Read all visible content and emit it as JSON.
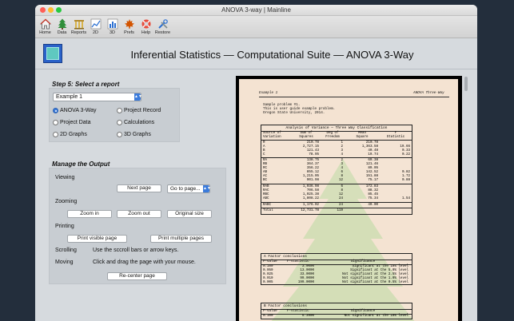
{
  "window": {
    "title": "ANOVA 3-way | Mainline"
  },
  "toolbar": {
    "items": [
      {
        "label": "Home",
        "icon": "home-icon"
      },
      {
        "label": "Data",
        "icon": "tree-icon"
      },
      {
        "label": "Reports",
        "icon": "columns-icon"
      },
      {
        "label": "2D",
        "icon": "line-chart-icon"
      },
      {
        "label": "3D",
        "icon": "bar-chart-icon"
      },
      {
        "label": "Prefs",
        "icon": "maple-leaf-icon"
      },
      {
        "label": "Help",
        "icon": "lifebuoy-icon"
      },
      {
        "label": "Restore",
        "icon": "tools-icon"
      }
    ]
  },
  "header": {
    "title": "Inferential Statistics — Computational Suite — ANOVA 3-Way"
  },
  "step5": {
    "title": "Step 5: Select a report",
    "selected_example": "Example 1",
    "options": [
      "ANOVA 3-Way",
      "Project Record",
      "Project Data",
      "Calculations",
      "2D Graphs",
      "3D Graphs"
    ],
    "selected_option": "ANOVA 3-Way"
  },
  "output": {
    "title": "Manage the Output",
    "viewing_label": "Viewing",
    "next_page": "Next page",
    "goto_page": "Go to page...",
    "zooming_label": "Zooming",
    "zoom_in": "Zoom in",
    "zoom_out": "Zoom out",
    "original_size": "Original size",
    "printing_label": "Printing",
    "print_visible": "Print visible page",
    "print_multiple": "Print multiple pages",
    "scrolling_label": "Scrolling",
    "scrolling_text": "Use the sccroll bars or arrow keys.",
    "moving_label": "Moving",
    "moving_text": "Click and drag the page with your mouse.",
    "recenter": "Re-center page"
  },
  "report": {
    "header_left": "Example 1",
    "header_right": "ANOVA Three-Way",
    "intro": [
      "Sample problem #1.",
      "This is user guide example problem.",
      "Oregon State University, 2014."
    ],
    "anova_caption": "Analysis of Variance — Three Way Classification",
    "anova_headers": [
      [
        "Source of",
        "Variation"
      ],
      [
        "Sum of",
        "Squares"
      ],
      [
        "Deg of",
        "Freedom"
      ],
      [
        "Mean",
        "Square"
      ],
      [
        "F",
        "Statistic"
      ]
    ],
    "anova_groups": [
      [
        [
          "R",
          "210.78",
          "1",
          "210.78",
          ""
        ],
        [
          "A",
          "2,727.15",
          "2",
          "1,363.58",
          "19.66"
        ],
        [
          "B",
          "121.43",
          "3",
          "40.48",
          "0.33"
        ],
        [
          "C",
          "78.95",
          "4",
          "19.74",
          "0.22"
        ]
      ],
      [
        [
          "RA",
          "138.75",
          "2",
          "69.38",
          ""
        ],
        [
          "RB",
          "364.37",
          "3",
          "121.46",
          ""
        ],
        [
          "RC",
          "356.22",
          "4",
          "89.05",
          ""
        ],
        [
          "AB",
          "855.12",
          "6",
          "142.52",
          "0.82"
        ],
        [
          "AC",
          "1,215.05",
          "8",
          "151.88",
          "1.72"
        ],
        [
          "BC",
          "901.98",
          "12",
          "75.17",
          "0.88"
        ]
      ],
      [
        [
          "RAB",
          "1,036.98",
          "6",
          "172.83",
          ""
        ],
        [
          "RAC",
          "706.58",
          "8",
          "88.32",
          ""
        ],
        [
          "RBC",
          "1,025.38",
          "12",
          "85.45",
          ""
        ],
        [
          "ABC",
          "1,808.22",
          "24",
          "75.34",
          "1.54"
        ]
      ],
      [
        [
          "RABC",
          "1,176.02",
          "24",
          "49.00",
          ""
        ]
      ],
      [
        [
          "Total",
          "12,731.78",
          "119",
          "",
          ""
        ]
      ]
    ],
    "a_caption": "A Factor conclusions",
    "b_caption": "B Factor conclusions",
    "concl_headers": [
      "P-value",
      "F-statistic",
      "Significance"
    ],
    "a_rows": [
      [
        "0.100",
        "3.0000",
        "Significant at the 10% level"
      ],
      [
        "0.050",
        "13.0000",
        "Significant at the 5.0% level"
      ],
      [
        "0.025",
        "33.0000",
        "Not significant at the 2.5% level"
      ],
      [
        "0.010",
        "99.0000",
        "Not significant at the 1.0% level"
      ],
      [
        "0.005",
        "199.0000",
        "Not significant at the 0.5% level"
      ]
    ],
    "b_rows": [
      [
        "0.100",
        "5.3900",
        "Not significant at the 10% level"
      ]
    ]
  }
}
